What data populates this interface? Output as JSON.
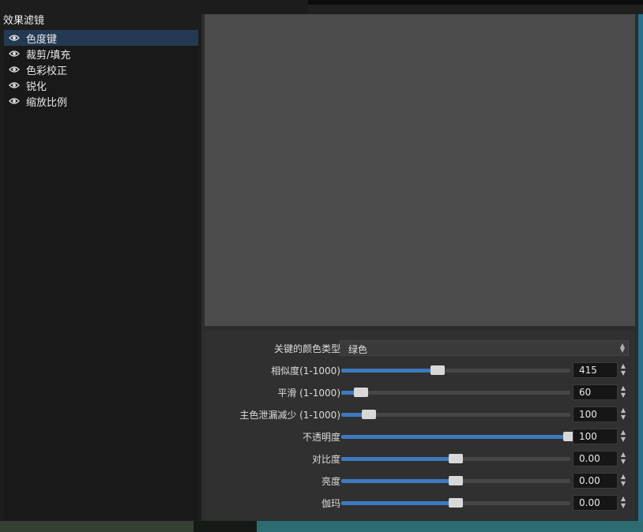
{
  "panel_title": "效果滤镜",
  "filters": [
    {
      "label": "色度键",
      "selected": true,
      "icon": "eye-icon"
    },
    {
      "label": "裁剪/填充",
      "selected": false,
      "icon": "eye-icon"
    },
    {
      "label": "色彩校正",
      "selected": false,
      "icon": "eye-icon"
    },
    {
      "label": "锐化",
      "selected": false,
      "icon": "eye-icon"
    },
    {
      "label": "缩放比例",
      "selected": false,
      "icon": "eye-icon"
    }
  ],
  "properties": {
    "key_color_type": {
      "label": "关键的颜色类型",
      "value": "绿色"
    },
    "sliders": [
      {
        "id": "similarity",
        "label": "相似度(1-1000)",
        "value": "415",
        "fraction": 0.42
      },
      {
        "id": "smoothness",
        "label": "平滑 (1-1000)",
        "value": "60",
        "fraction": 0.087
      },
      {
        "id": "spill-reduction",
        "label": "主色泄漏减少 (1-1000)",
        "value": "100",
        "fraction": 0.12
      },
      {
        "id": "opacity",
        "label": "不透明度",
        "value": "100",
        "fraction": 1.0
      },
      {
        "id": "contrast",
        "label": "对比度",
        "value": "0.00",
        "fraction": 0.5
      },
      {
        "id": "brightness",
        "label": "亮度",
        "value": "0.00",
        "fraction": 0.5
      },
      {
        "id": "gamma",
        "label": "伽玛",
        "value": "0.00",
        "fraction": 0.5
      }
    ]
  },
  "colors": {
    "accent": "#3d7ac0",
    "selection": "#243a52",
    "preview": "#4b4b4b"
  }
}
